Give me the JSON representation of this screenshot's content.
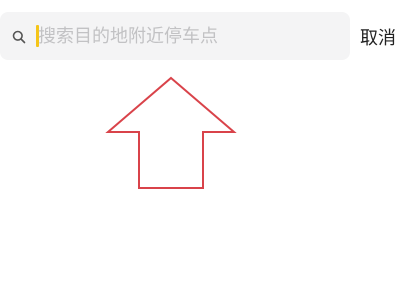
{
  "search": {
    "placeholder": "搜索目的地附近停车点",
    "value": ""
  },
  "actions": {
    "cancel_label": "取消"
  },
  "colors": {
    "search_bar_bg": "#f4f4f5",
    "caret": "#f5c518",
    "placeholder": "#c2c2c4",
    "annotation_arrow": "#d9434a"
  },
  "icons": {
    "search": "search-icon",
    "annotation": "arrow-up-icon"
  }
}
